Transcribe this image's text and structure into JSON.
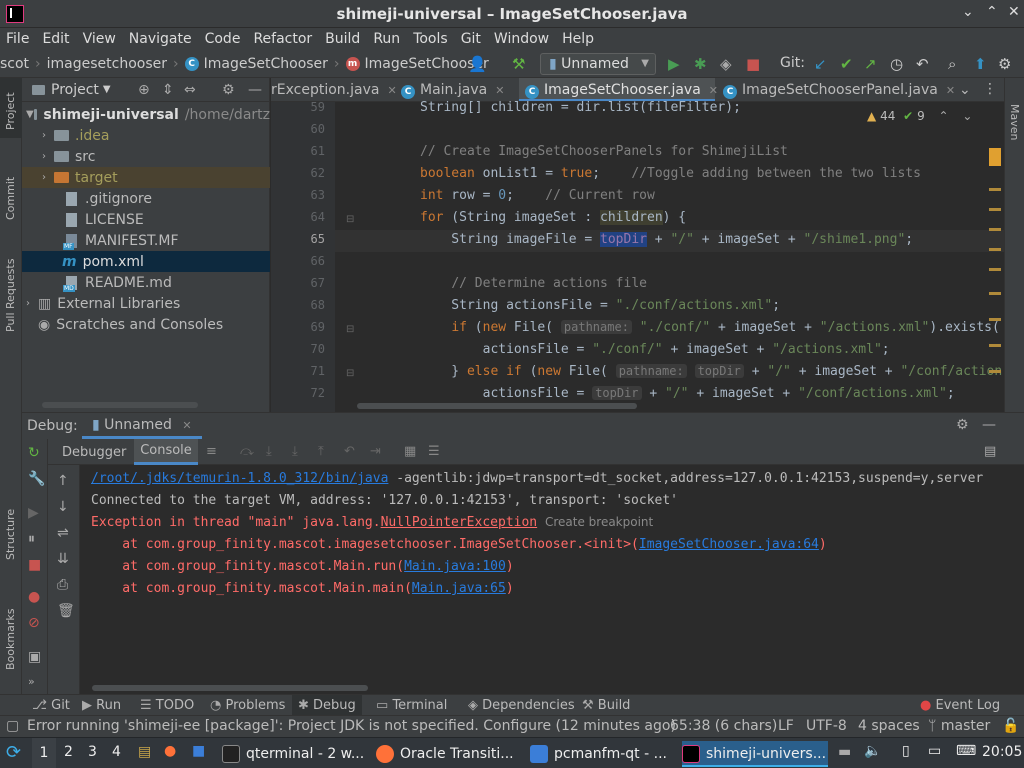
{
  "window": {
    "title": "shimeji-universal – ImageSetChooser.java"
  },
  "menu": [
    "File",
    "Edit",
    "View",
    "Navigate",
    "Code",
    "Refactor",
    "Build",
    "Run",
    "Tools",
    "Git",
    "Window",
    "Help"
  ],
  "breadcrumb": [
    "scot",
    "imagesetchooser",
    "ImageSetChooser",
    "ImageSetChooser"
  ],
  "toolbar": {
    "run_config": "Unnamed",
    "git_label": "Git:"
  },
  "left_stripe": [
    "Project",
    "Commit",
    "Pull Requests"
  ],
  "left_stripe_bottom": [
    "Structure",
    "Bookmarks"
  ],
  "right_stripe": [
    "Maven"
  ],
  "project": {
    "header": "Project",
    "root": "shimeji-universal",
    "root_path": "/home/dartz",
    "items": [
      ".idea",
      "src",
      "target",
      ".gitignore",
      "LICENSE",
      "MANIFEST.MF",
      "pom.xml",
      "README.md",
      "External Libraries",
      "Scratches and Consoles"
    ]
  },
  "tabs": [
    "rException.java",
    "Main.java",
    "ImageSetChooser.java",
    "ImageSetChooserPanel.java"
  ],
  "inspections": {
    "warnings": "44",
    "ok": "9"
  },
  "editor": {
    "line_numbers": [
      "59",
      "60",
      "61",
      "62",
      "63",
      "64",
      "65",
      "66",
      "67",
      "68",
      "69",
      "70",
      "71",
      "72"
    ],
    "current_line": "65"
  },
  "debug": {
    "title": "Debug:",
    "session": "Unnamed",
    "tabs": [
      "Debugger",
      "Console"
    ],
    "console": {
      "cmd_path": "/root/.jdks/temurin-1.8.0_312/bin/java",
      "cmd_args": " -agentlib:jdwp=transport=dt_socket,address=127.0.0.1:42153,suspend=y,server",
      "connected": "Connected to the target VM, address: '127.0.0.1:42153', transport: 'socket'",
      "exception_prefix": "Exception in thread \"main\" java.lang.",
      "exception_class": "NullPointerException",
      "create_breakpoint": "Create breakpoint",
      "trace": [
        {
          "at": "    at com.group_finity.mascot.imagesetchooser.ImageSetChooser.<init>(",
          "link": "ImageSetChooser.java:64",
          "end": ")"
        },
        {
          "at": "    at com.group_finity.mascot.Main.run(",
          "link": "Main.java:100",
          "end": ")"
        },
        {
          "at": "    at com.group_finity.mascot.Main.main(",
          "link": "Main.java:65",
          "end": ")"
        }
      ]
    }
  },
  "bottom_tools": [
    "Git",
    "Run",
    "TODO",
    "Problems",
    "Debug",
    "Terminal",
    "Dependencies",
    "Build",
    "Event Log"
  ],
  "status": {
    "message": "Error running 'shimeji-ee [package]': Project JDK is not specified. Configure (12 minutes ago)",
    "position": "65:38 (6 chars)",
    "line_sep": "LF",
    "encoding": "UTF-8",
    "indent": "4 spaces",
    "branch": "master"
  },
  "taskbar": {
    "desktops": [
      "1",
      "2",
      "3",
      "4"
    ],
    "tasks": [
      "qterminal - 2 w...",
      "Oracle Transiti...",
      "pcmanfm-qt - ...",
      "shimeji-univers..."
    ],
    "clock": "20:05"
  }
}
